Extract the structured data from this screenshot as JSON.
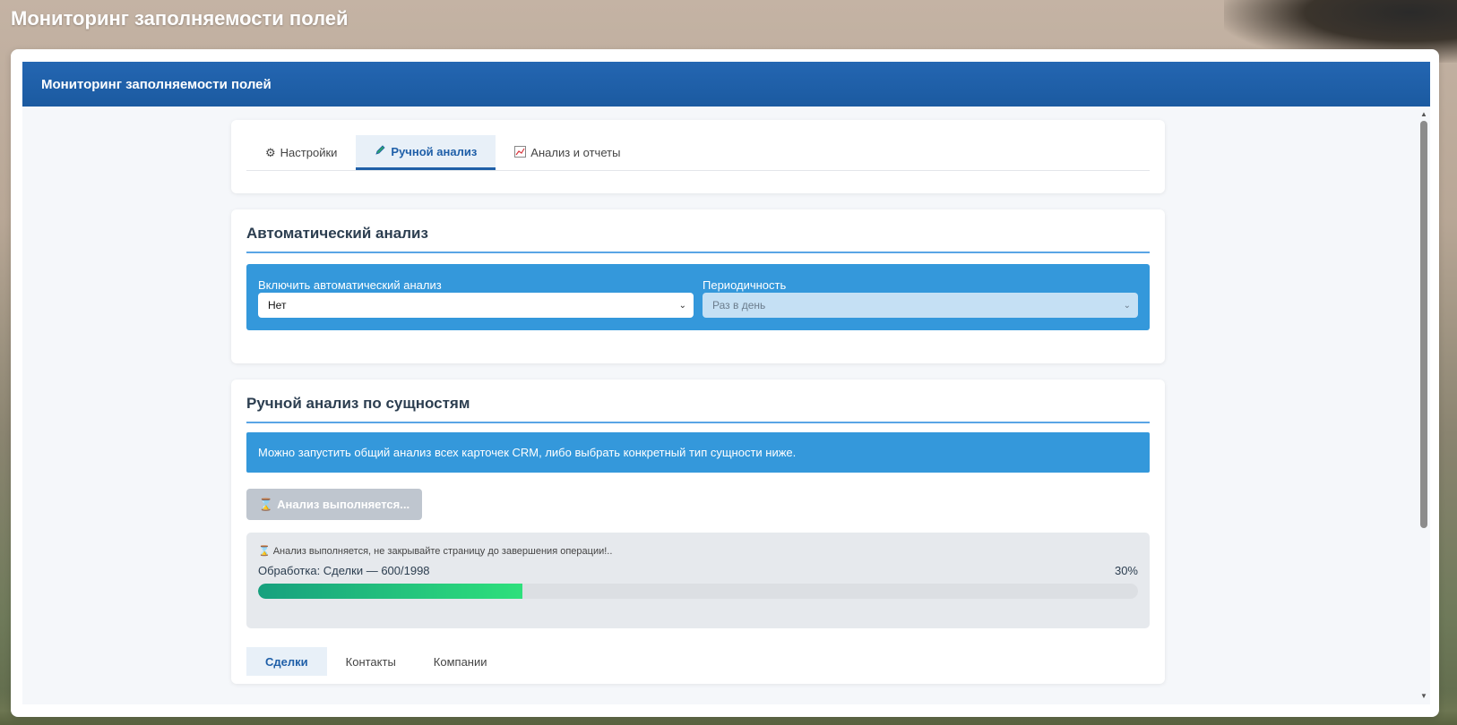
{
  "page_title": "Мониторинг заполняемости полей",
  "app_header": "Мониторинг заполняемости полей",
  "tabs": [
    {
      "label": "Настройки",
      "icon": "gear-icon",
      "active": false
    },
    {
      "label": "Ручной анализ",
      "icon": "pencil-icon",
      "active": true
    },
    {
      "label": "Анализ и отчеты",
      "icon": "chart-icon",
      "active": false
    }
  ],
  "auto": {
    "title": "Автоматический анализ",
    "enable_label": "Включить автоматический анализ",
    "enable_value": "Нет",
    "period_label": "Периодичность",
    "period_value": "Раз в день"
  },
  "manual": {
    "title": "Ручной анализ по сущностям",
    "info": "Можно запустить общий анализ всех карточек CRM, либо выбрать конкретный тип сущности ниже.",
    "run_button": "Анализ выполняется...",
    "warning": "Анализ выполняется, не закрывайте страницу до завершения операции!..",
    "processing_text": "Обработка: Сделки — 600/1998",
    "percent_text": "30%",
    "progress": 0.3
  },
  "entity_tabs": [
    {
      "label": "Сделки",
      "active": true
    },
    {
      "label": "Контакты",
      "active": false
    },
    {
      "label": "Компании",
      "active": false
    }
  ],
  "colors": {
    "header": "#1f5fa8",
    "accent": "#3498db",
    "progress_start": "#17a07e",
    "progress_end": "#2ee07c"
  }
}
